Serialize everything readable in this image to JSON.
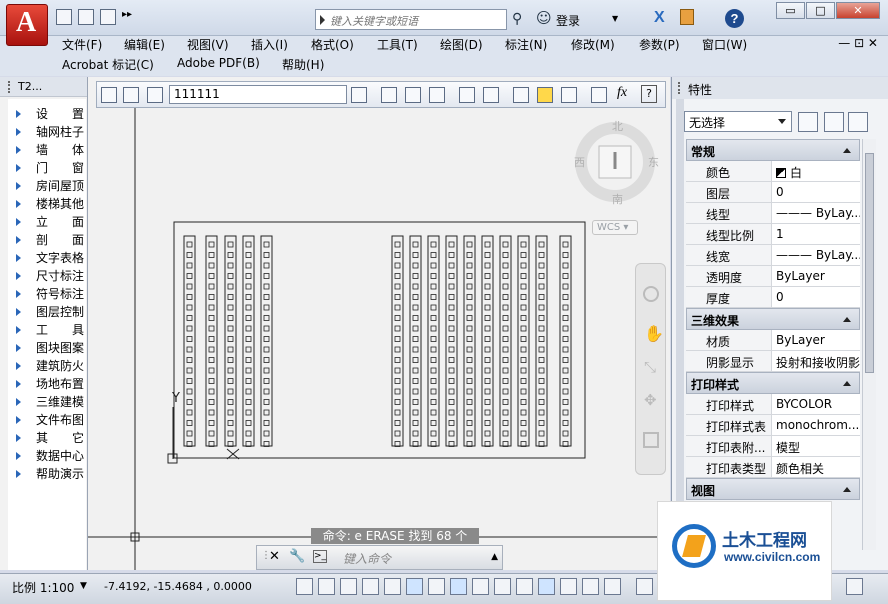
{
  "titlebar": {
    "search_placeholder": "键入关键字或短语",
    "login_label": "登录",
    "window_controls": [
      "▭",
      "□",
      "✕"
    ],
    "help_label": "?"
  },
  "menubar": {
    "row1": [
      "文件(F)",
      "编辑(E)",
      "视图(V)",
      "插入(I)",
      "格式(O)",
      "工具(T)",
      "绘图(D)",
      "标注(N)",
      "修改(M)",
      "参数(P)",
      "窗口(W)"
    ],
    "row2": [
      "Acrobat 标记(C)",
      "Adobe PDF(B)",
      "帮助(H)"
    ],
    "mdi_controls": "— ⊡ ✕"
  },
  "left_panel": {
    "title": "T2...",
    "items": [
      "设 置",
      "轴网柱子",
      "墙 体",
      "门 窗",
      "房间屋顶",
      "楼梯其他",
      "立 面",
      "剖 面",
      "文字表格",
      "尺寸标注",
      "符号标注",
      "图层控制",
      "工 具",
      "图块图案",
      "建筑防火",
      "场地布置",
      "三维建模",
      "文件布图",
      "其 它",
      "数据中心",
      "帮助演示"
    ]
  },
  "drawing_toolbar": {
    "input_value": "111111"
  },
  "canvas": {
    "compass": {
      "north": "北",
      "south": "南",
      "east": "东",
      "west": "西"
    },
    "wcs_label": "WCS",
    "ucs_y_label": "Y",
    "command_readout": "命令: e ERASE 找到 68 个",
    "command_placeholder": "键入命令"
  },
  "properties": {
    "title": "特性",
    "selection": "无选择",
    "sections": [
      {
        "name": "常规",
        "rows": [
          {
            "key": "颜色",
            "value": "白"
          },
          {
            "key": "图层",
            "value": "0"
          },
          {
            "key": "线型",
            "value": "——— ByLay..."
          },
          {
            "key": "线型比例",
            "value": "1"
          },
          {
            "key": "线宽",
            "value": "——— ByLay..."
          },
          {
            "key": "透明度",
            "value": "ByLayer"
          },
          {
            "key": "厚度",
            "value": "0"
          }
        ]
      },
      {
        "name": "三维效果",
        "rows": [
          {
            "key": "材质",
            "value": "ByLayer"
          },
          {
            "key": "阴影显示",
            "value": "投射和接收阴影"
          }
        ]
      },
      {
        "name": "打印样式",
        "rows": [
          {
            "key": "打印样式",
            "value": "BYCOLOR"
          },
          {
            "key": "打印样式表",
            "value": "monochrom..."
          },
          {
            "key": "打印表附...",
            "value": "模型"
          },
          {
            "key": "打印表类型",
            "value": "颜色相关"
          }
        ]
      },
      {
        "name": "视图",
        "rows": []
      }
    ]
  },
  "statusbar": {
    "scale": "比例 1:100",
    "coords": "-7.4192,   -15.4684  ,  0.0000"
  },
  "watermark": {
    "title": "土木工程网",
    "url": "www.civilcn.com"
  }
}
